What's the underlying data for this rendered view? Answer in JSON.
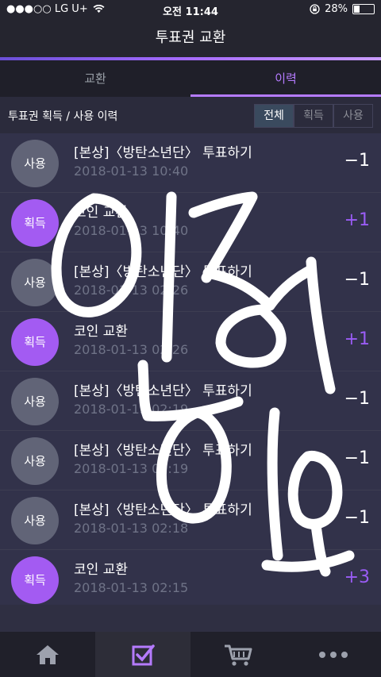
{
  "status": {
    "carrier": "●●●○○ LG U+",
    "time": "오전 11:44",
    "battery": "28%",
    "battery_level": 0.28
  },
  "header": {
    "title": "투표권 교환"
  },
  "tabs": [
    {
      "label": "교환",
      "active": false
    },
    {
      "label": "이력",
      "active": true
    }
  ],
  "filter": {
    "title": "투표권 획득 / 사용 이력",
    "options": [
      {
        "label": "전체",
        "active": true
      },
      {
        "label": "획득",
        "active": false
      },
      {
        "label": "사용",
        "active": false
      }
    ]
  },
  "rows": [
    {
      "badge": "사용",
      "type": "use",
      "title": "[본상]〈방탄소년단〉 투표하기",
      "time": "2018-01-13 10:40",
      "amount": "−1"
    },
    {
      "badge": "획득",
      "type": "get",
      "title": "코인 교환",
      "time": "2018-01-13 10:40",
      "amount": "+1"
    },
    {
      "badge": "사용",
      "type": "use",
      "title": "[본상]〈방탄소년단〉 투표하기",
      "time": "2018-01-13 02:26",
      "amount": "−1"
    },
    {
      "badge": "획득",
      "type": "get",
      "title": "코인 교환",
      "time": "2018-01-13 02:26",
      "amount": "+1"
    },
    {
      "badge": "사용",
      "type": "use",
      "title": "[본상]〈방탄소년단〉 투표하기",
      "time": "2018-01-13 02:19",
      "amount": "−1"
    },
    {
      "badge": "사용",
      "type": "use",
      "title": "[본상]〈방탄소년단〉 투표하기",
      "time": "2018-01-13 02:19",
      "amount": "−1"
    },
    {
      "badge": "사용",
      "type": "use",
      "title": "[본상]〈방탄소년단〉 투표하기",
      "time": "2018-01-13 02:18",
      "amount": "−1"
    },
    {
      "badge": "획득",
      "type": "get",
      "title": "코인 교환",
      "time": "2018-01-13 02:15",
      "amount": "+3"
    }
  ],
  "nav": [
    {
      "icon": "home-icon",
      "active": false
    },
    {
      "icon": "vote-check-icon",
      "active": true
    },
    {
      "icon": "cart-icon",
      "active": false
    },
    {
      "icon": "more-icon",
      "active": false
    }
  ],
  "colors": {
    "accent": "#b57bff",
    "badge_get": "#a35bf2",
    "badge_use": "#616477",
    "positive_amount": "#9a5cf5"
  }
}
